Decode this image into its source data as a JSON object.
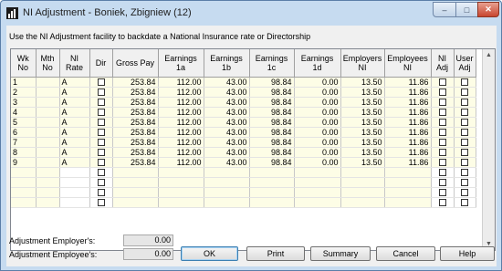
{
  "window": {
    "title": "NI Adjustment - Boniek, Zbigniew  (12)",
    "minimize": "–",
    "maximize": "□",
    "close": "✕"
  },
  "instruction": "Use the NI Adjustment facility to backdate a National Insurance rate or Directorship",
  "table": {
    "headers": [
      "Wk No",
      "Mth No",
      "NI Rate",
      "Dir",
      "Gross Pay",
      "Earnings 1a",
      "Earnings 1b",
      "Earnings 1c",
      "Earnings 1d",
      "Employers NI",
      "Employees NI",
      "NI Adj",
      "User Adj"
    ],
    "rows": [
      {
        "wk": "1",
        "mth": "",
        "rate": "A",
        "gross": "253.84",
        "e1a": "112.00",
        "e1b": "43.00",
        "e1c": "98.84",
        "e1d": "0.00",
        "ers": "13.50",
        "ees": "11.86"
      },
      {
        "wk": "2",
        "mth": "",
        "rate": "A",
        "gross": "253.84",
        "e1a": "112.00",
        "e1b": "43.00",
        "e1c": "98.84",
        "e1d": "0.00",
        "ers": "13.50",
        "ees": "11.86"
      },
      {
        "wk": "3",
        "mth": "",
        "rate": "A",
        "gross": "253.84",
        "e1a": "112.00",
        "e1b": "43.00",
        "e1c": "98.84",
        "e1d": "0.00",
        "ers": "13.50",
        "ees": "11.86"
      },
      {
        "wk": "4",
        "mth": "",
        "rate": "A",
        "gross": "253.84",
        "e1a": "112.00",
        "e1b": "43.00",
        "e1c": "98.84",
        "e1d": "0.00",
        "ers": "13.50",
        "ees": "11.86"
      },
      {
        "wk": "5",
        "mth": "",
        "rate": "A",
        "gross": "253.84",
        "e1a": "112.00",
        "e1b": "43.00",
        "e1c": "98.84",
        "e1d": "0.00",
        "ers": "13.50",
        "ees": "11.86"
      },
      {
        "wk": "6",
        "mth": "",
        "rate": "A",
        "gross": "253.84",
        "e1a": "112.00",
        "e1b": "43.00",
        "e1c": "98.84",
        "e1d": "0.00",
        "ers": "13.50",
        "ees": "11.86"
      },
      {
        "wk": "7",
        "mth": "",
        "rate": "A",
        "gross": "253.84",
        "e1a": "112.00",
        "e1b": "43.00",
        "e1c": "98.84",
        "e1d": "0.00",
        "ers": "13.50",
        "ees": "11.86"
      },
      {
        "wk": "8",
        "mth": "",
        "rate": "A",
        "gross": "253.84",
        "e1a": "112.00",
        "e1b": "43.00",
        "e1c": "98.84",
        "e1d": "0.00",
        "ers": "13.50",
        "ees": "11.86"
      },
      {
        "wk": "9",
        "mth": "",
        "rate": "A",
        "gross": "253.84",
        "e1a": "112.00",
        "e1b": "43.00",
        "e1c": "98.84",
        "e1d": "0.00",
        "ers": "13.50",
        "ees": "11.86"
      },
      {
        "wk": "",
        "mth": "",
        "rate": "",
        "gross": "",
        "e1a": "",
        "e1b": "",
        "e1c": "",
        "e1d": "",
        "ers": "",
        "ees": ""
      },
      {
        "wk": "",
        "mth": "",
        "rate": "",
        "gross": "",
        "e1a": "",
        "e1b": "",
        "e1c": "",
        "e1d": "",
        "ers": "",
        "ees": ""
      },
      {
        "wk": "",
        "mth": "",
        "rate": "",
        "gross": "",
        "e1a": "",
        "e1b": "",
        "e1c": "",
        "e1d": "",
        "ers": "",
        "ees": ""
      },
      {
        "wk": "",
        "mth": "",
        "rate": "",
        "gross": "",
        "e1a": "",
        "e1b": "",
        "e1c": "",
        "e1d": "",
        "ers": "",
        "ees": ""
      }
    ]
  },
  "adjustments": {
    "employer_label": "Adjustment Employer's:",
    "employer_value": "0.00",
    "employee_label": "Adjustment Employee's:",
    "employee_value": "0.00"
  },
  "buttons": {
    "ok": "OK",
    "print": "Print",
    "summary": "Summary",
    "cancel": "Cancel",
    "help": "Help"
  },
  "icons": {
    "app": "chart-icon",
    "scroll_up": "▲",
    "scroll_down": "▼"
  }
}
